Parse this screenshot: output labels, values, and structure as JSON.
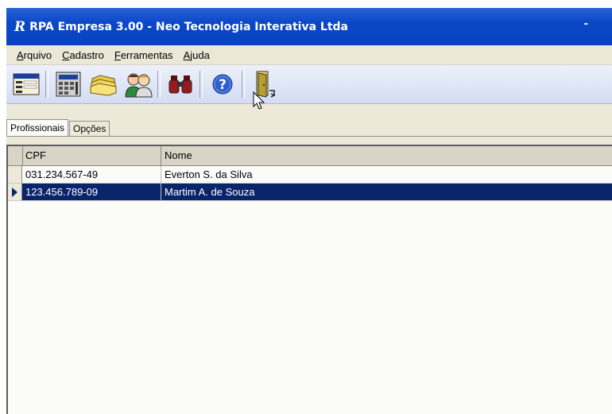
{
  "window": {
    "title": "RPA Empresa 3.00 - Neo Tecnologia Interativa Ltda",
    "minimize": "-"
  },
  "app_icon": "R",
  "menu": [
    {
      "label": "Arquivo"
    },
    {
      "label": "Cadastro"
    },
    {
      "label": "Ferramentas"
    },
    {
      "label": "Ajuda"
    }
  ],
  "toolbar_icons": [
    "form-icon",
    "calculator-icon",
    "folders-icon",
    "people-icon",
    "binoculars-icon",
    "help-icon",
    "exit-door-icon"
  ],
  "tabs": [
    {
      "label": "Profissionais",
      "active": true
    },
    {
      "label": "Opções",
      "active": false
    }
  ],
  "grid": {
    "columns": [
      "CPF",
      "Nome"
    ],
    "rows": [
      {
        "cpf": "031.234.567-49",
        "nome": "Everton S. da Silva",
        "selected": false
      },
      {
        "cpf": "123.456.789-09",
        "nome": "Martim A. de Souza",
        "selected": true
      }
    ]
  },
  "colors": {
    "titlebar": "#0a47c8",
    "selection": "#0a246a",
    "toolbar": "#d3dcf3"
  }
}
